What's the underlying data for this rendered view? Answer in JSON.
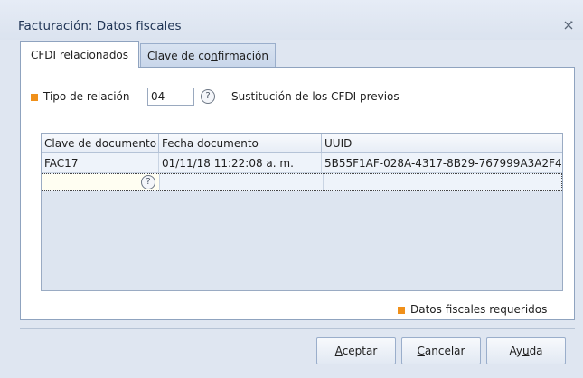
{
  "window": {
    "title": "Facturación: Datos fiscales"
  },
  "tabs": {
    "related_pre": "C",
    "related_u": "F",
    "related_post": "DI relacionados",
    "confirm_pre": "Clave de co",
    "confirm_u": "n",
    "confirm_post": "firmación"
  },
  "relation": {
    "label": "Tipo de relación",
    "code": "04",
    "help": "?",
    "description": "Sustitución de los CFDI previos"
  },
  "grid": {
    "headers": [
      "Clave de documento",
      "Fecha documento",
      "UUID"
    ],
    "rows": [
      [
        "FAC17",
        "01/11/18 11:22:08 a. m.",
        "5B55F1AF-028A-4317-8B29-767999A3A2F4"
      ]
    ],
    "new_row_help": "?"
  },
  "legend": {
    "required_label": "Datos fiscales requeridos"
  },
  "buttons": {
    "accept_u": "A",
    "accept_post": "ceptar",
    "cancel_u": "C",
    "cancel_post": "ancelar",
    "help_pre": "Ay",
    "help_u": "u",
    "help_post": "da"
  },
  "colors": {
    "accent_orange": "#f0901a",
    "window_bg": "#dfe6f1"
  },
  "icons": {
    "close": "close-icon",
    "help": "question-circle-icon",
    "required_marker": "orange-square-icon"
  }
}
